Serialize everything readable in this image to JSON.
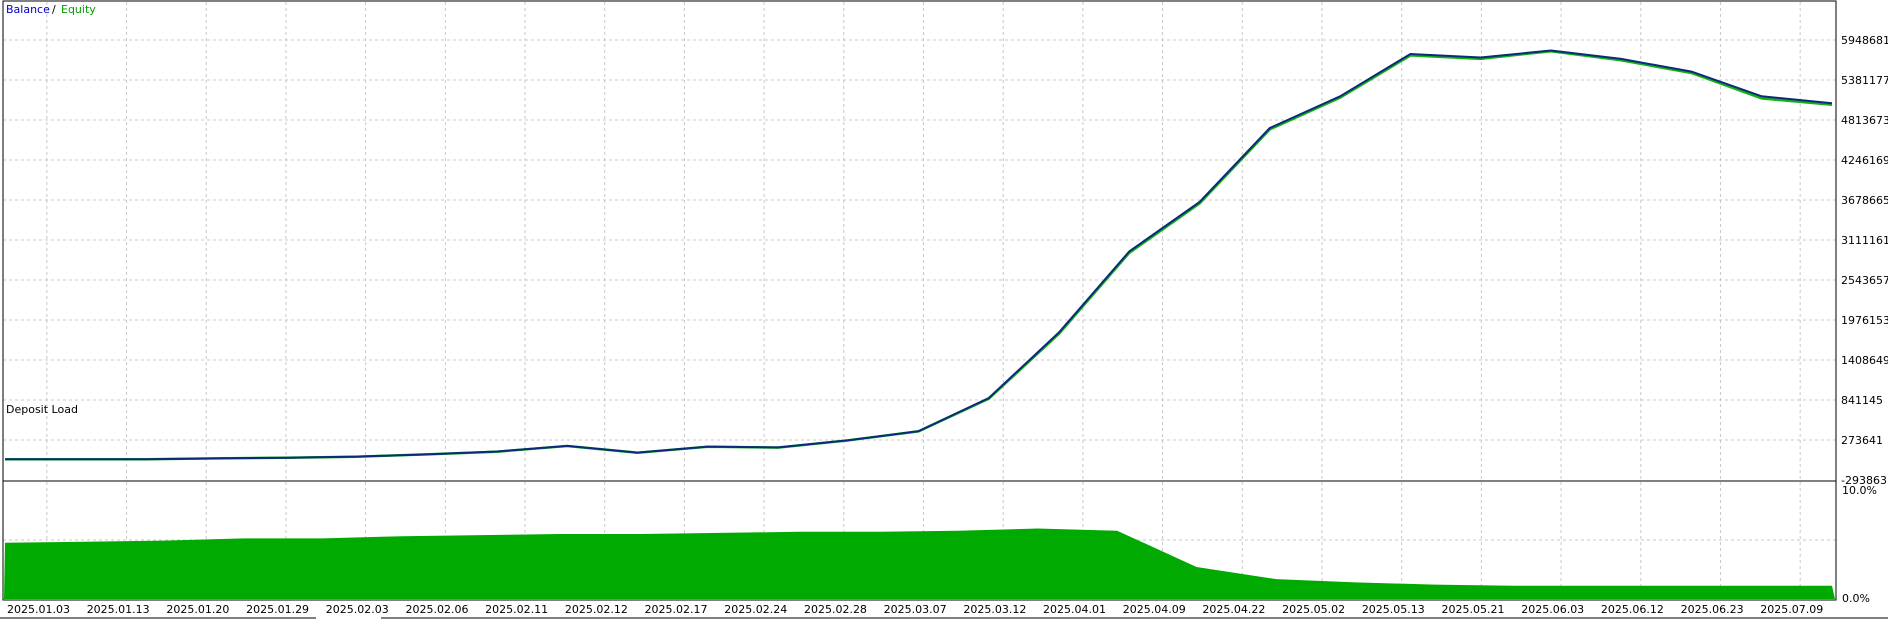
{
  "legend": {
    "balance": "Balance",
    "separator": "/",
    "equity": "Equity"
  },
  "colors": {
    "balance": "#0a2a7a",
    "equity": "#13b013",
    "deposit_load": "#00aa00",
    "grid": "#c8c8c8",
    "frame": "#000000"
  },
  "chart_data": [
    {
      "type": "line",
      "series": [
        {
          "name": "Balance",
          "values": [
            0,
            0,
            0,
            12000,
            22000,
            38000,
            70000,
            110000,
            190000,
            95000,
            180000,
            168000,
            270000,
            400000,
            870000,
            1800000,
            2950000,
            3650000,
            4700000,
            5150000,
            5750000,
            5700000,
            5800000,
            5680000,
            5500000,
            5150000,
            5050000
          ]
        },
        {
          "name": "Equity",
          "values": [
            0,
            0,
            0,
            12000,
            22000,
            37000,
            69000,
            108000,
            188000,
            94000,
            179000,
            166000,
            268000,
            395000,
            860000,
            1780000,
            2930000,
            3630000,
            4680000,
            5130000,
            5730000,
            5680000,
            5790000,
            5660000,
            5480000,
            5120000,
            5030000
          ]
        }
      ],
      "x": [
        "2025.01.03",
        "2025.01.13",
        "2025.01.20",
        "2025.01.29",
        "2025.02.03",
        "2025.02.06",
        "2025.02.11",
        "2025.02.12",
        "2025.02.17",
        "2025.02.24",
        "2025.02.28",
        "2025.03.07",
        "2025.03.12",
        "2025.04.01",
        "2025.04.09",
        "2025.04.22",
        "2025.05.02",
        "2025.05.13",
        "2025.05.21",
        "2025.06.03",
        "2025.06.12",
        "2025.06.23",
        "2025.07.09"
      ],
      "yticks": [
        "5948681",
        "5381177",
        "4813673",
        "4246169",
        "3678665",
        "3111161",
        "2543657",
        "1976153",
        "1408649",
        "841145",
        "273641",
        "-293863"
      ],
      "ylim": [
        -293863,
        6300000
      ],
      "grid": true,
      "legend": "top-left"
    },
    {
      "type": "area",
      "title": "Deposit Load",
      "series": [
        {
          "name": "Deposit Load",
          "values": [
            5.2,
            5.3,
            5.4,
            5.6,
            5.6,
            5.8,
            5.9,
            6.0,
            6.0,
            6.1,
            6.2,
            6.2,
            6.3,
            6.5,
            6.3,
            3.0,
            1.9,
            1.6,
            1.4,
            1.3,
            1.3,
            1.3,
            1.3,
            1.3
          ]
        }
      ],
      "yticks": [
        "10.0%",
        "0.0%"
      ],
      "ylim": [
        0,
        10
      ],
      "grid": true
    }
  ]
}
